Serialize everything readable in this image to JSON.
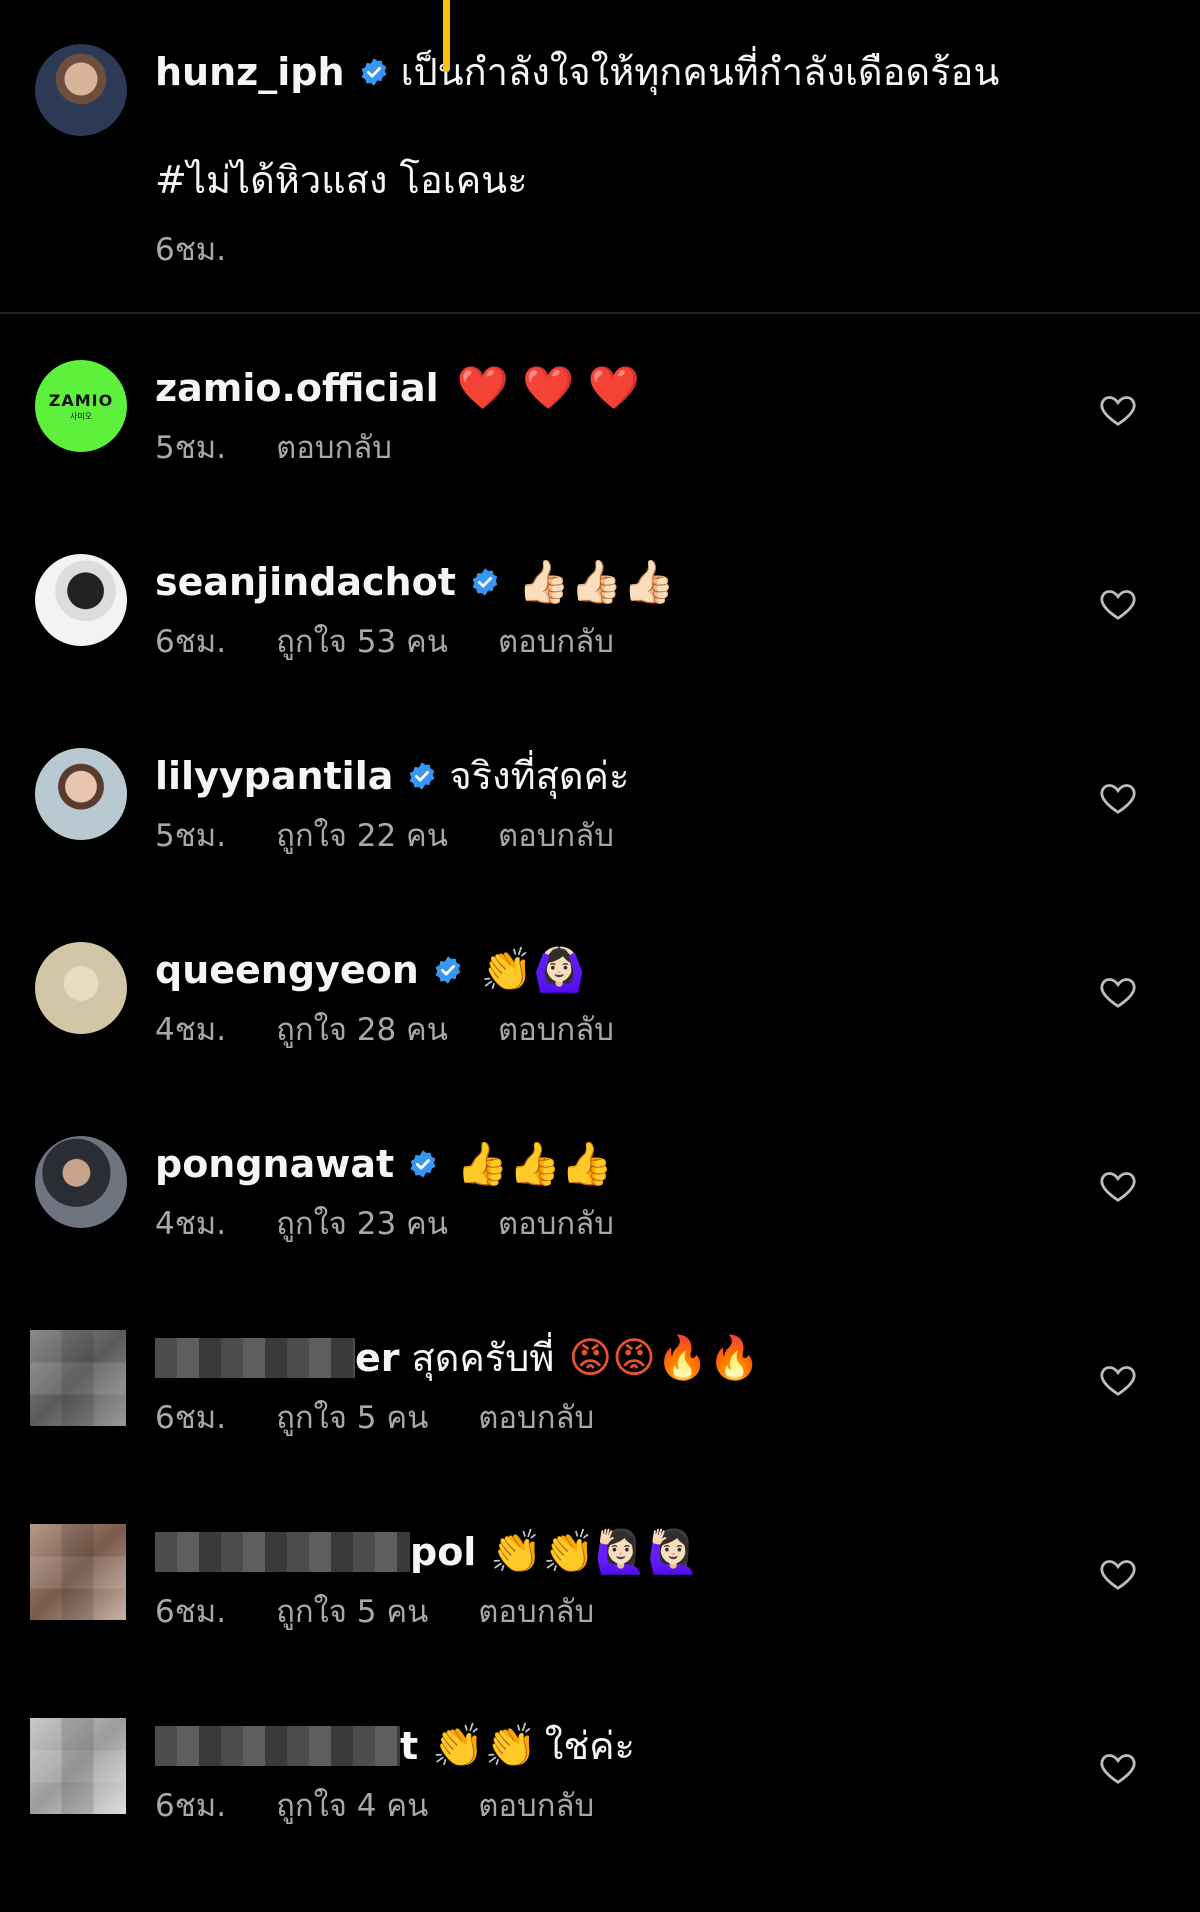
{
  "caption": {
    "username": "hunz_iph",
    "verified": true,
    "text": "เป็นกำลังใจให้ทุกคนที่กำลังเดือดร้อน",
    "hashtag": "#ไม่ได้หิวแสง โอเคนะ",
    "time": "6ชม."
  },
  "comments": [
    {
      "username": "zamio.official",
      "verified": false,
      "text": "",
      "emoji": "❤️ ❤️ ❤️",
      "time": "5ชม.",
      "likes": "",
      "reply": "ตอบกลับ",
      "avatar_label": "ZAMIO",
      "avatar_sub": "사미오"
    },
    {
      "username": "seanjindachot",
      "verified": true,
      "text": "",
      "emoji": "👍🏻👍🏻👍🏻",
      "time": "6ชม.",
      "likes": "ถูกใจ 53 คน",
      "reply": "ตอบกลับ"
    },
    {
      "username": "lilyypantila",
      "verified": true,
      "text": "จริงที่สุดค่ะ",
      "emoji": "",
      "time": "5ชม.",
      "likes": "ถูกใจ 22 คน",
      "reply": "ตอบกลับ"
    },
    {
      "username": "queengyeon",
      "verified": true,
      "text": "",
      "emoji": "👏🙆🏻‍♀️",
      "time": "4ชม.",
      "likes": "ถูกใจ 28 คน",
      "reply": "ตอบกลับ"
    },
    {
      "username": "pongnawat",
      "verified": true,
      "text": "",
      "emoji": "👍👍👍",
      "time": "4ชม.",
      "likes": "ถูกใจ 23 คน",
      "reply": "ตอบกลับ"
    },
    {
      "username": "er",
      "verified": false,
      "text": "สุดครับพี่",
      "emoji": "😡😡🔥🔥",
      "time": "6ชม.",
      "likes": "ถูกใจ 5 คน",
      "reply": "ตอบกลับ",
      "blurred": true
    },
    {
      "username": "pol",
      "verified": false,
      "text": "",
      "emoji": "👏👏🙋🏻‍♀️🙋🏻‍♀️",
      "time": "6ชม.",
      "likes": "ถูกใจ 5 คน",
      "reply": "ตอบกลับ",
      "blurred": true
    },
    {
      "username": "t",
      "verified": false,
      "text": "ใช่ค่ะ",
      "emoji": "👏👏",
      "time": "6ชม.",
      "likes": "ถูกใจ 4 คน",
      "reply": "ตอบกลับ",
      "blurred": true
    }
  ],
  "colors": {
    "background": "#000000",
    "text": "#f5f5f5",
    "meta": "#a8a8a8",
    "verified": "#3897f0",
    "zamio_green": "#5df03c",
    "highlight": "#f4c20d"
  },
  "icons": {
    "verified": "verified-badge-icon",
    "like": "heart-outline-icon"
  }
}
